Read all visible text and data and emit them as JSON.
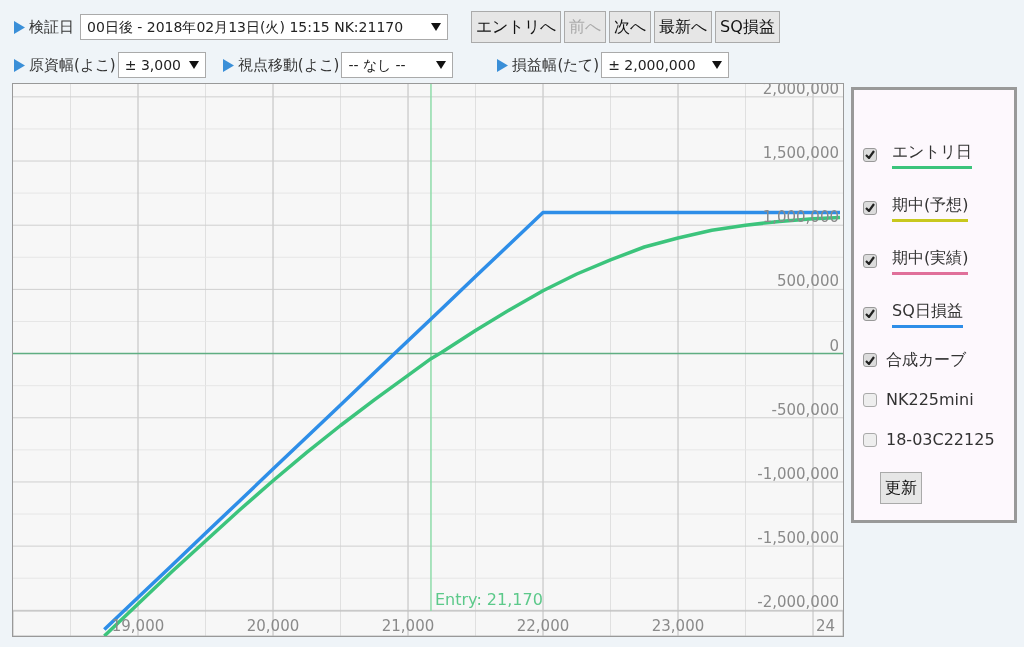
{
  "toolbar": {
    "date": {
      "label": "検証日",
      "value": "00日後 - 2018年02月13日(火) 15:15 NK:21170"
    },
    "buttons": [
      {
        "label": "エントリへ",
        "disabled": false
      },
      {
        "label": "前へ",
        "disabled": true
      },
      {
        "label": "次へ",
        "disabled": false
      },
      {
        "label": "最新へ",
        "disabled": false
      },
      {
        "label": "SQ損益",
        "disabled": false
      }
    ],
    "range_x": {
      "label": "原資幅(よこ)",
      "value": "± 3,000"
    },
    "pan": {
      "label": "視点移動(よこ)",
      "value": "-- なし --"
    },
    "range_y": {
      "label": "損益幅(たて)",
      "value": "± 2,000,000"
    }
  },
  "chart": {
    "chart_data": {
      "type": "line",
      "x": [
        18750,
        19000,
        19250,
        19500,
        19750,
        20000,
        20250,
        20500,
        20750,
        21000,
        21170,
        21250,
        21500,
        21750,
        22000,
        22250,
        22500,
        22750,
        23000,
        23250,
        23500,
        23750,
        24000,
        24200
      ],
      "series": [
        {
          "color": "#3cc47c",
          "values": [
            -2200000,
            -1950000,
            -1700000,
            -1460000,
            -1220000,
            -990000,
            -770000,
            -560000,
            -360000,
            -170000,
            -40000,
            10000,
            180000,
            340000,
            490000,
            620000,
            730000,
            830000,
            900000,
            960000,
            1000000,
            1030000,
            1050000,
            1060000
          ]
        },
        {
          "color": "#2e8ee8",
          "values": [
            -2150000,
            -1900000,
            -1650000,
            -1400000,
            -1150000,
            -900000,
            -650000,
            -400000,
            -150000,
            100000,
            270000,
            350000,
            600000,
            850000,
            1100000,
            1100000,
            1100000,
            1100000,
            1100000,
            1100000,
            1100000,
            1100000,
            1100000,
            1100000
          ]
        }
      ],
      "xlim": [
        18074,
        24222
      ],
      "ylim": [
        -2200000,
        2100000
      ],
      "xticks": [
        {
          "value": 19000,
          "label": "19,000"
        },
        {
          "value": 20000,
          "label": "20,000"
        },
        {
          "value": 21000,
          "label": "21,000"
        },
        {
          "value": 22000,
          "label": "22,000"
        },
        {
          "value": 23000,
          "label": "23,000"
        }
      ],
      "yticks": [
        {
          "value": 2000000,
          "label": "2,000,000"
        },
        {
          "value": 1500000,
          "label": "1,500,000"
        },
        {
          "value": 1000000,
          "label": "1,000,000"
        },
        {
          "value": 500000,
          "label": "500,000"
        },
        {
          "value": 0,
          "label": "0"
        },
        {
          "value": -500000,
          "label": "-500,000"
        },
        {
          "value": -1000000,
          "label": "-1,000,000"
        },
        {
          "value": -1500000,
          "label": "-1,500,000"
        },
        {
          "value": -2000000,
          "label": "-2,000,000"
        }
      ],
      "grid": true,
      "ref_lines": [
        {
          "axis": "x",
          "value": 21170,
          "color": "#8fdcaa"
        },
        {
          "axis": "y",
          "value": 0,
          "color": "#5fae82"
        }
      ],
      "annotations": [
        "Entry: 21,170"
      ]
    },
    "cut_tick_label": "24"
  },
  "legend": {
    "items": [
      {
        "label": "エントリ日",
        "kind": "line",
        "checked": true,
        "color": "#3cc47c"
      },
      {
        "label": "期中(予想)",
        "kind": "line",
        "checked": true,
        "color": "#c8c81e"
      },
      {
        "label": "期中(実績)",
        "kind": "line",
        "checked": true,
        "color": "#e0709a"
      },
      {
        "label": "SQ日損益",
        "kind": "line",
        "checked": true,
        "color": "#2e8ee8"
      },
      {
        "label": "合成カーブ",
        "kind": "plain",
        "checked": true
      },
      {
        "label": "NK225mini",
        "kind": "plain",
        "checked": false
      },
      {
        "label": "18-03C22125",
        "kind": "plain",
        "checked": false
      }
    ],
    "update_button": "更新"
  }
}
